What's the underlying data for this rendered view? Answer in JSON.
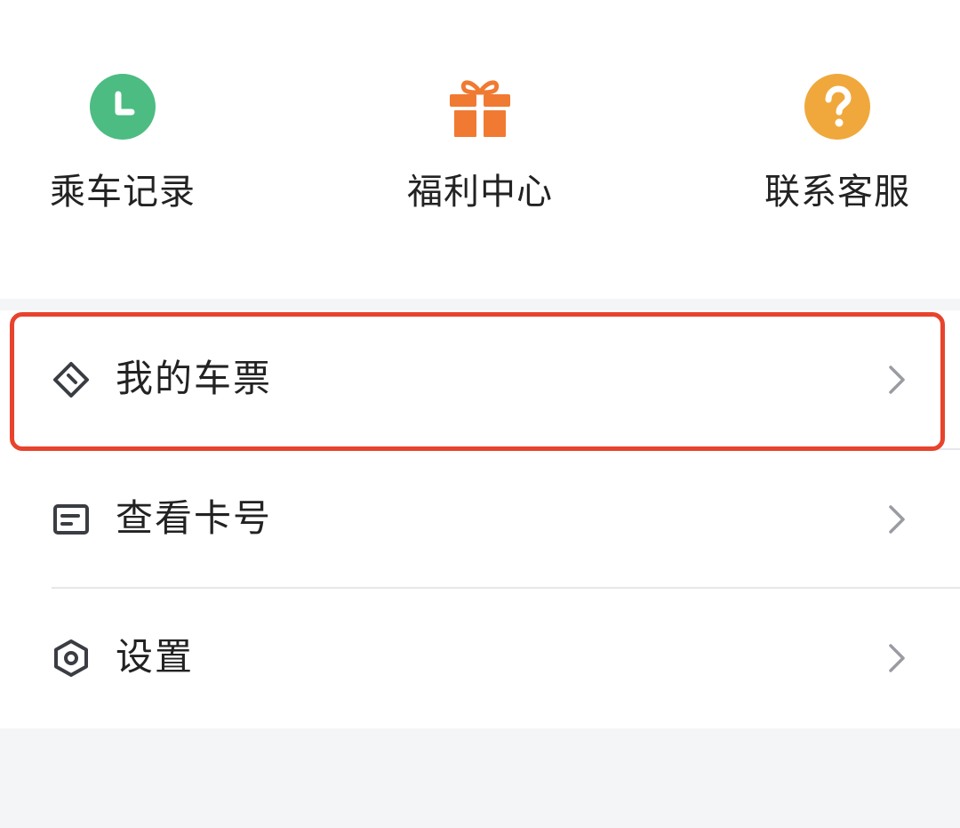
{
  "quick_actions": [
    {
      "label": "乘车记录",
      "icon": "clock-icon",
      "color": "#4cbc82"
    },
    {
      "label": "福利中心",
      "icon": "gift-icon",
      "color": "#f07a32"
    },
    {
      "label": "联系客服",
      "icon": "question-icon",
      "color": "#f0a83c"
    }
  ],
  "menu": {
    "items": [
      {
        "label": "我的车票",
        "icon": "ticket-icon"
      },
      {
        "label": "查看卡号",
        "icon": "card-icon"
      },
      {
        "label": "设置",
        "icon": "settings-icon"
      }
    ]
  },
  "colors": {
    "highlight": "#e8432d",
    "page_background": "#f4f5f7",
    "text": "#222222",
    "icon_gray": "#3a3d42",
    "chevron_gray": "#9a9ca2"
  }
}
